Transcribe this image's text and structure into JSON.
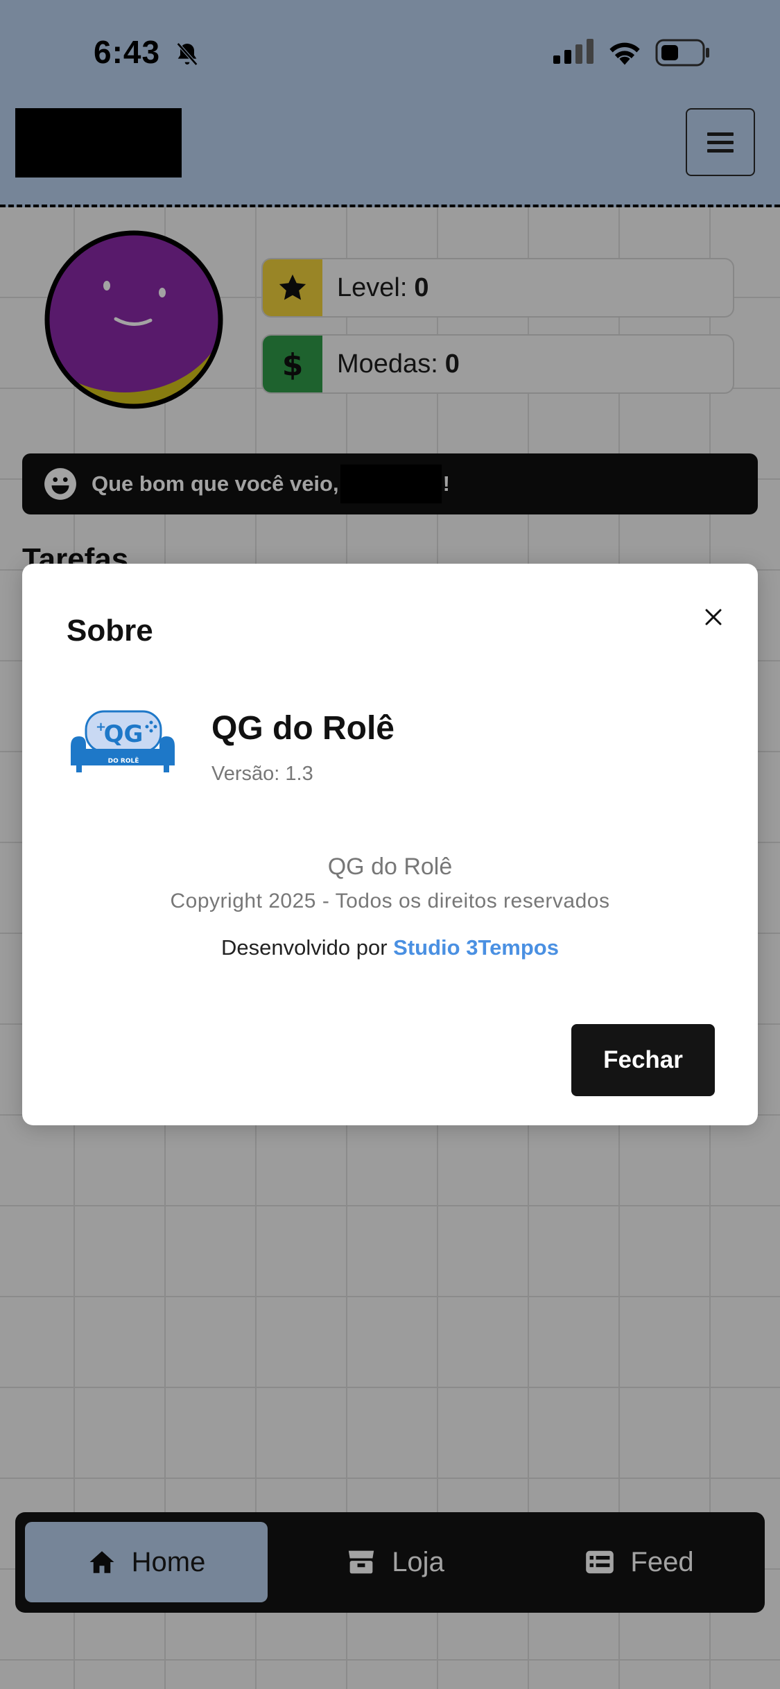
{
  "status_bar": {
    "time": "6:43"
  },
  "header": {
    "menu_label": "≡"
  },
  "stats": {
    "level_label": "Level:",
    "level_value": "0",
    "coins_label": "Moedas:",
    "coins_value": "0"
  },
  "greeting": {
    "text": "Que bom que você veio,",
    "suffix": "!"
  },
  "section": {
    "title": "Tarefas"
  },
  "modal": {
    "title": "Sobre",
    "logo_text_main": "QG",
    "logo_text_sub": "DO ROLÊ",
    "app_name": "QG do Rolê",
    "version": "Versão: 1.3",
    "center_name": "QG do Rolê",
    "copyright": "Copyright 2025 - Todos os direitos reservados",
    "developed_by_prefix": "Desenvolvido por",
    "developer_name": "Studio 3Tempos",
    "close_label": "Fechar"
  },
  "nav": {
    "items": [
      {
        "label": "Home",
        "icon": "home-icon",
        "active": true
      },
      {
        "label": "Loja",
        "icon": "store-icon",
        "active": false
      },
      {
        "label": "Feed",
        "icon": "feed-icon",
        "active": false
      }
    ]
  },
  "colors": {
    "header_bg": "#b9d0ee",
    "level_icon_bg": "#f0d03c",
    "coins_icon_bg": "#2f9a48",
    "avatar_purple": "#8a2aa8",
    "avatar_yellow": "#d4c21a",
    "link_blue": "#4a90e2",
    "dark": "#141414"
  }
}
